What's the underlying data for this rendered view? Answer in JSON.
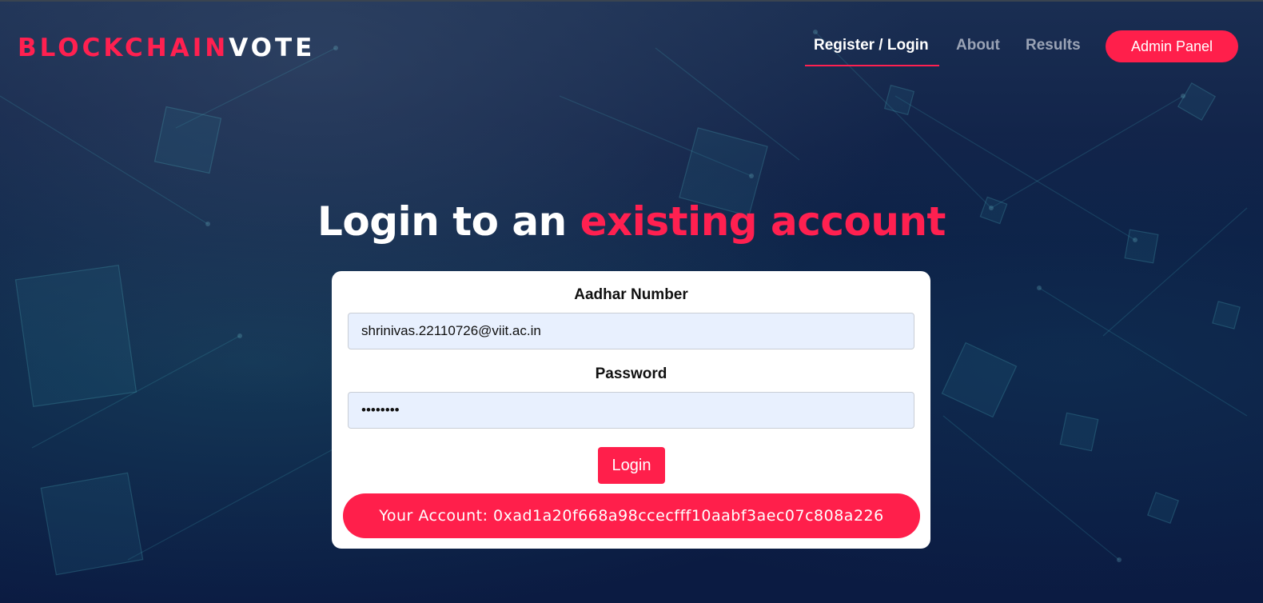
{
  "brand": {
    "part1": "BLOCKCHAIN",
    "part2": "VOTE"
  },
  "nav": {
    "items": [
      {
        "label": "Register / Login",
        "active": true
      },
      {
        "label": "About",
        "active": false
      },
      {
        "label": "Results",
        "active": false
      }
    ],
    "admin_label": "Admin Panel"
  },
  "heading": {
    "part1": "Login to an ",
    "part2": "existing account"
  },
  "form": {
    "aadhar_label": "Aadhar Number",
    "aadhar_value": "shrinivas.22110726@viit.ac.in",
    "password_label": "Password",
    "password_value": "••••••••",
    "login_label": "Login"
  },
  "account": {
    "text": "Your Account: 0xad1a20f668a98ccecfff10aabf3aec07c808a226"
  },
  "colors": {
    "accent": "#ff1f4b",
    "background": "#0b1b42",
    "input_bg": "#e8f0fe"
  }
}
